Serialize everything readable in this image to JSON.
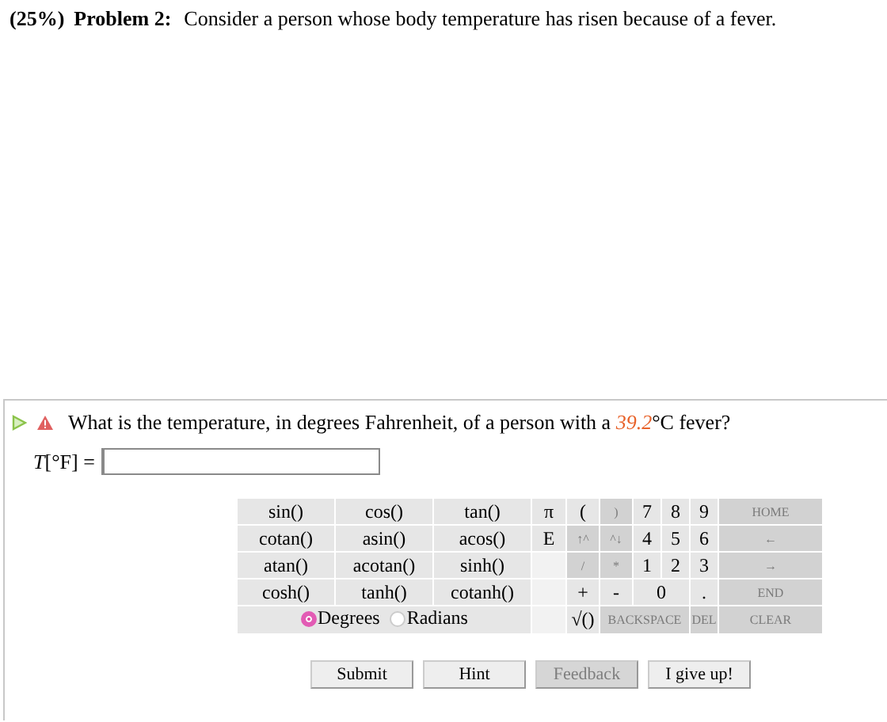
{
  "problem": {
    "weight": "(25%)",
    "title": "Problem 2:",
    "text": "Consider a person whose body temperature has risen because of a fever."
  },
  "part": {
    "question": "What is the temperature, in degrees Fahrenheit, of a person with a *39.2*°C fever?",
    "answer_label": "*T*[°F] ="
  },
  "keypad": {
    "rows": [
      [
        {
          "kind": "key",
          "label": "sin()",
          "disabled": false
        },
        {
          "kind": "key",
          "label": "cos()",
          "disabled": false
        },
        {
          "kind": "key",
          "label": "tan()",
          "disabled": false
        },
        {
          "kind": "key",
          "label": "π",
          "disabled": false
        },
        {
          "kind": "key",
          "label": "(",
          "disabled": false
        },
        {
          "kind": "key",
          "label": ")",
          "disabled": true
        },
        {
          "kind": "key",
          "label": "7",
          "disabled": false
        },
        {
          "kind": "key",
          "label": "8",
          "disabled": false
        },
        {
          "kind": "key",
          "label": "9",
          "disabled": false
        },
        {
          "kind": "key",
          "label": "HOME",
          "disabled": true
        }
      ],
      [
        {
          "kind": "key",
          "label": "cotan()",
          "disabled": false
        },
        {
          "kind": "key",
          "label": "asin()",
          "disabled": false
        },
        {
          "kind": "key",
          "label": "acos()",
          "disabled": false
        },
        {
          "kind": "key",
          "label": "E",
          "disabled": false
        },
        {
          "kind": "key",
          "label": "↑^",
          "disabled": true
        },
        {
          "kind": "key",
          "label": "^↓",
          "disabled": true
        },
        {
          "kind": "key",
          "label": "4",
          "disabled": false
        },
        {
          "kind": "key",
          "label": "5",
          "disabled": false
        },
        {
          "kind": "key",
          "label": "6",
          "disabled": false
        },
        {
          "kind": "key",
          "label": "←",
          "disabled": true
        }
      ],
      [
        {
          "kind": "key",
          "label": "atan()",
          "disabled": false
        },
        {
          "kind": "key",
          "label": "acotan()",
          "disabled": false
        },
        {
          "kind": "key",
          "label": "sinh()",
          "disabled": false
        },
        {
          "kind": "blank"
        },
        {
          "kind": "key",
          "label": "/",
          "disabled": true
        },
        {
          "kind": "key",
          "label": "*",
          "disabled": true
        },
        {
          "kind": "key",
          "label": "1",
          "disabled": false
        },
        {
          "kind": "key",
          "label": "2",
          "disabled": false
        },
        {
          "kind": "key",
          "label": "3",
          "disabled": false
        },
        {
          "kind": "key",
          "label": "→",
          "disabled": true
        }
      ],
      [
        {
          "kind": "key",
          "label": "cosh()",
          "disabled": false
        },
        {
          "kind": "key",
          "label": "tanh()",
          "disabled": false
        },
        {
          "kind": "key",
          "label": "cotanh()",
          "disabled": false
        },
        {
          "kind": "blank"
        },
        {
          "kind": "key",
          "label": "+",
          "disabled": false
        },
        {
          "kind": "key",
          "label": "-",
          "disabled": false
        },
        {
          "kind": "key",
          "label": "0",
          "disabled": false,
          "colspan": 2
        },
        {
          "kind": "key",
          "label": ".",
          "disabled": false
        },
        {
          "kind": "key",
          "label": "END",
          "disabled": true
        }
      ],
      [
        {
          "kind": "radio",
          "colspan": 3,
          "options": [
            {
              "label": "Degrees",
              "selected": true
            },
            {
              "label": "Radians",
              "selected": false
            }
          ]
        },
        {
          "kind": "blank"
        },
        {
          "kind": "key",
          "label": "√()",
          "disabled": false
        },
        {
          "kind": "key",
          "label": "BACKSPACE",
          "disabled": true,
          "colspan": 3
        },
        {
          "kind": "key",
          "label": "DEL",
          "disabled": true
        },
        {
          "kind": "key",
          "label": "CLEAR",
          "disabled": true
        }
      ]
    ]
  },
  "buttons": [
    {
      "label": "Submit",
      "disabled": false
    },
    {
      "label": "Hint",
      "disabled": false
    },
    {
      "label": "Feedback",
      "disabled": true
    },
    {
      "label": "I give up!",
      "disabled": false
    }
  ]
}
